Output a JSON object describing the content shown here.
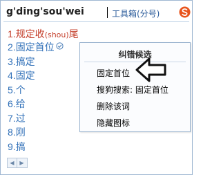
{
  "header": {
    "pinyin": "g'ding'sou'wei",
    "toolbox_label": "工具箱(分号)",
    "logo_icon": "sogou-logo-icon"
  },
  "candidates": [
    {
      "num": "1.",
      "text": "规定收",
      "pinyin_note": "(shou)",
      "tail": "尾",
      "selected": true
    },
    {
      "num": "2.",
      "text": "固定首位",
      "badge_icon": "check-circle-icon"
    },
    {
      "num": "3.",
      "text": "搞定"
    },
    {
      "num": "4.",
      "text": "固定"
    },
    {
      "num": "5.",
      "text": "个"
    },
    {
      "num": "6.",
      "text": "给"
    },
    {
      "num": "7.",
      "text": "过"
    },
    {
      "num": "8.",
      "text": "刚"
    },
    {
      "num": "9.",
      "text": "搞"
    }
  ],
  "popup": {
    "title": "纠错候选",
    "items": [
      {
        "label": "固定首位"
      },
      {
        "label": "搜狗搜索: 固定首位"
      },
      {
        "label": "删除该词"
      },
      {
        "label": "隐藏图标"
      }
    ],
    "pointer_icon": "arrow-left-icon"
  },
  "paging": {
    "prev_icon": "triangle-left-icon",
    "next_icon": "triangle-right-icon"
  },
  "colors": {
    "candidate": "#3070b8",
    "selected_candidate": "#c43e2a",
    "border": "#9fb7d2"
  }
}
